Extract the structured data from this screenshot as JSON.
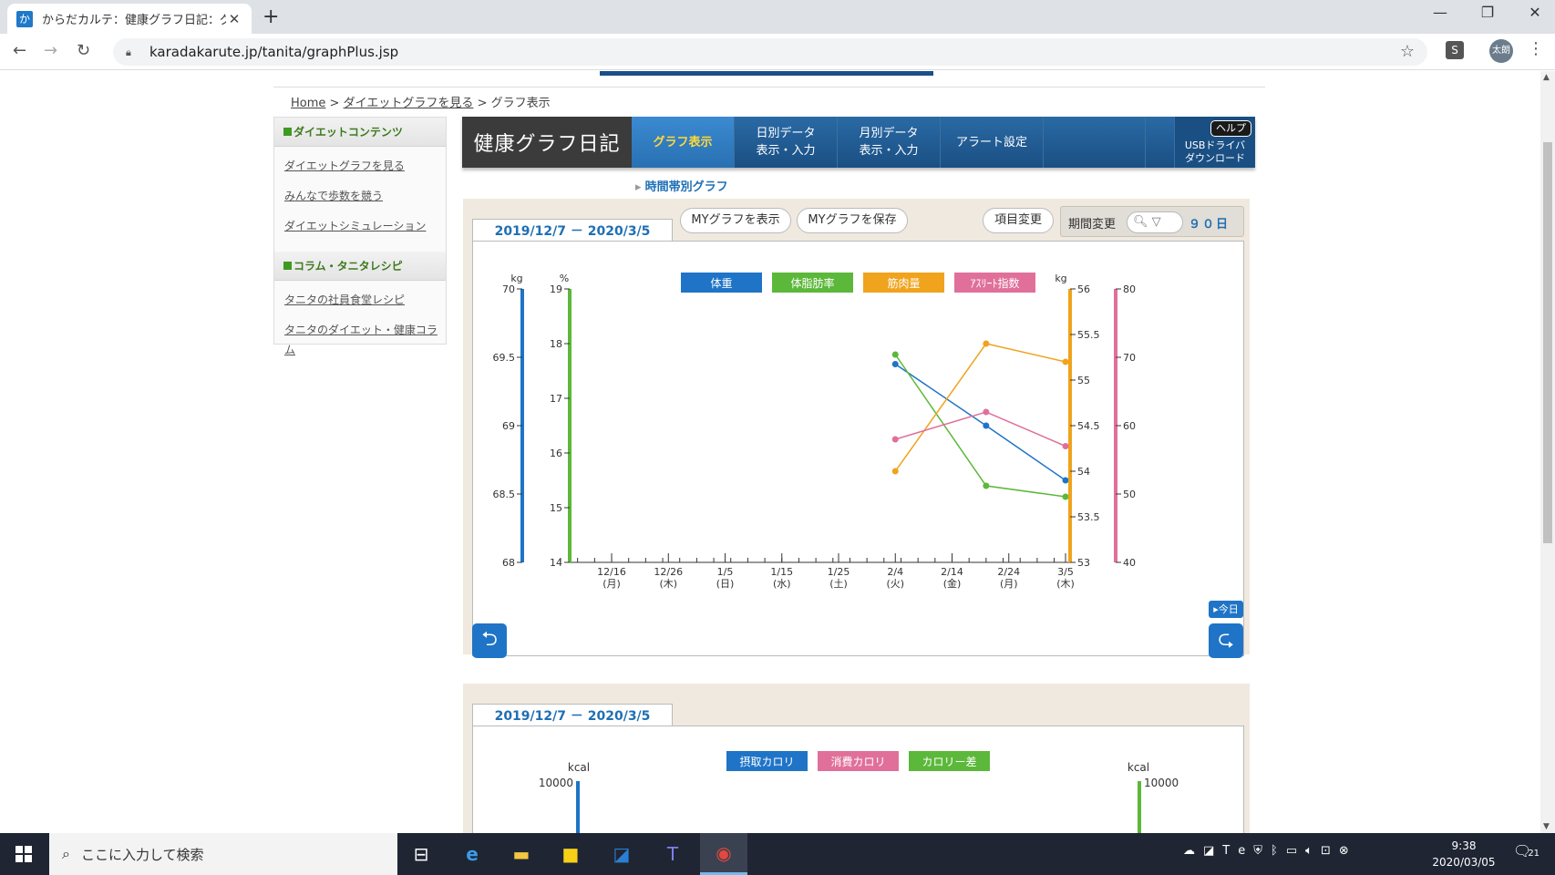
{
  "browser": {
    "tab_title": "からだカルテ：健康グラフ日記：グラ",
    "favicon_text": "か",
    "url": "karadakarute.jp/tanita/graphPlus.jsp",
    "extension_label": "S",
    "profile_name": "太朗"
  },
  "breadcrumb": {
    "home": "Home",
    "sep1": " > ",
    "diet_graph": "ダイエットグラフを見る",
    "sep2": " > ",
    "current": "グラフ表示"
  },
  "sidebar": {
    "section1_title": "ダイエットコンテンツ",
    "section1_items": [
      "ダイエットグラフを見る",
      "みんなで歩数を競う",
      "ダイエットシミュレーション"
    ],
    "section2_title": "コラム・タニタレシピ",
    "section2_items": [
      "タニタの社員食堂レシピ",
      "タニタのダイエット・健康コラム"
    ]
  },
  "header": {
    "logo": "健康グラフ日記",
    "nav": [
      "グラフ表示",
      "日別データ\n表示・入力",
      "月別データ\n表示・入力",
      "アラート設定"
    ],
    "help": "ヘルプ",
    "usb": "USBドライバ\nダウンロード",
    "subtab": "時間帯別グラフ"
  },
  "toolbar": {
    "date_range": "2019/12/7 － 2020/3/5",
    "show_my_graph": "MYグラフを表示",
    "save_my_graph": "MYグラフを保存",
    "change_items": "項目変更",
    "change_period": "期間変更",
    "period_value": "９０日",
    "today": "▸今日"
  },
  "chart_data": [
    {
      "type": "line",
      "x_dates": [
        "2020/2/4",
        "2020/2/20",
        "2020/3/5"
      ],
      "x_ticks": [
        {
          "label": "12/16",
          "day": "(月)"
        },
        {
          "label": "12/26",
          "day": "(木)"
        },
        {
          "label": "1/5",
          "day": "(日)"
        },
        {
          "label": "1/15",
          "day": "(水)"
        },
        {
          "label": "1/25",
          "day": "(土)"
        },
        {
          "label": "2/4",
          "day": "(火)"
        },
        {
          "label": "2/14",
          "day": "(金)"
        },
        {
          "label": "2/24",
          "day": "(月)"
        },
        {
          "label": "3/5",
          "day": "(木)"
        }
      ],
      "x_range": [
        "2019/12/7",
        "2020/3/5"
      ],
      "legend": [
        "体重",
        "体脂肪率",
        "筋肉量",
        "ｱｽﾘｰﾄ指数"
      ],
      "series": [
        {
          "name": "体重",
          "color": "#1f74c7",
          "axis": "left1",
          "unit": "kg",
          "ylim": [
            68,
            70
          ],
          "ticks": [
            "68",
            "68.5",
            "69",
            "69.5",
            "70"
          ],
          "values": [
            69.45,
            69.0,
            68.6
          ]
        },
        {
          "name": "体脂肪率",
          "color": "#5cb83a",
          "axis": "left2",
          "unit": "%",
          "ylim": [
            14,
            19
          ],
          "ticks": [
            "14",
            "15",
            "16",
            "17",
            "18",
            "19"
          ],
          "values": [
            17.8,
            15.4,
            15.2
          ]
        },
        {
          "name": "筋肉量",
          "color": "#f0a31d",
          "axis": "right1",
          "unit": "kg",
          "ylim": [
            53,
            56
          ],
          "ticks": [
            "53",
            "53.5",
            "54",
            "54.5",
            "55",
            "55.5",
            "56"
          ],
          "values": [
            54.0,
            55.4,
            55.2
          ]
        },
        {
          "name": "ｱｽﾘｰﾄ指数",
          "color": "#e0709a",
          "axis": "right2",
          "unit": "",
          "ylim": [
            40,
            80
          ],
          "ticks": [
            "40",
            "50",
            "60",
            "70",
            "80"
          ],
          "values": [
            58,
            62,
            57
          ]
        }
      ]
    },
    {
      "type": "bar",
      "legend": [
        "摂取カロリ",
        "消費カロリ",
        "カロリー差"
      ],
      "left_unit": "kcal",
      "right_unit": "kcal",
      "left_top": "10000",
      "right_top": "10000"
    }
  ],
  "taskbar": {
    "search_placeholder": "ここに入力して検索",
    "time": "9:38",
    "date": "2020/03/05",
    "notification_count": "21"
  }
}
